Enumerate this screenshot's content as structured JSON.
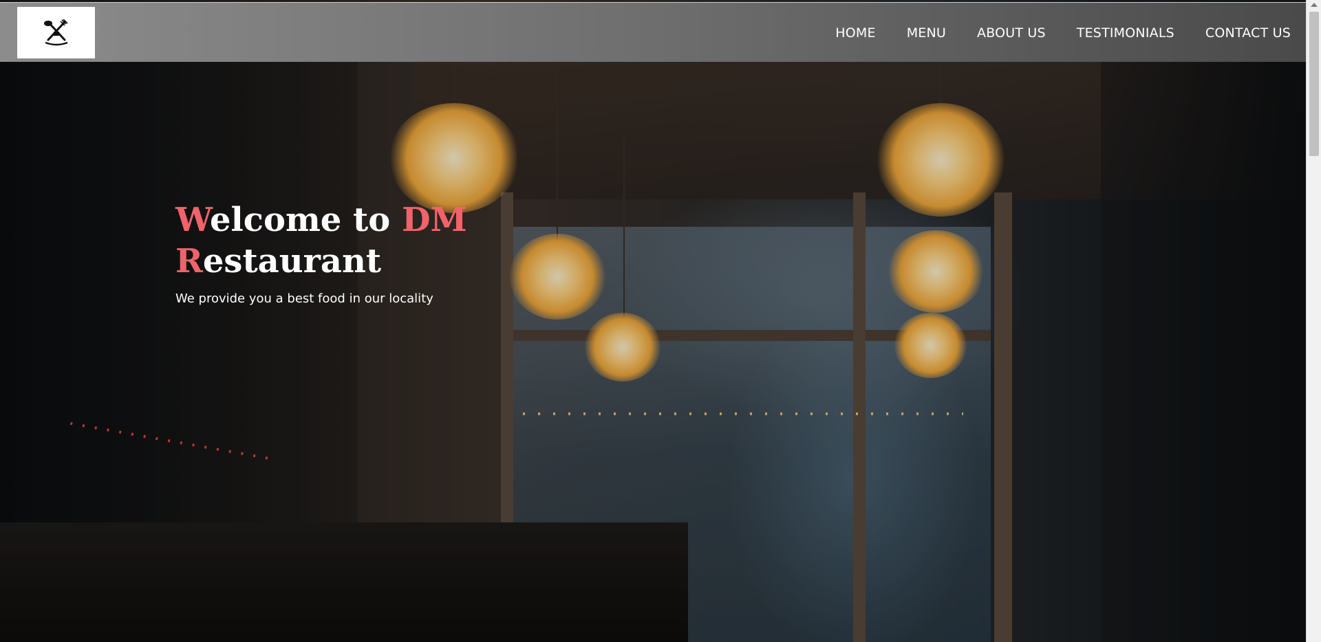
{
  "header": {
    "logo_alt": "DM Restaurant logo",
    "logo_icon": "fork-knife-icon"
  },
  "nav": {
    "items": [
      {
        "label": "HOME"
      },
      {
        "label": "MENU"
      },
      {
        "label": "ABOUT US"
      },
      {
        "label": "TESTIMONIALS"
      },
      {
        "label": "CONTACT US"
      }
    ]
  },
  "hero": {
    "title_line1_accent": "W",
    "title_line1_rest": "elcome to ",
    "title_line1_accent2": "DM",
    "title_line2_accent": "R",
    "title_line2_rest": "estaurant",
    "subtitle": "We provide you a best food in our locality",
    "accent_color": "#f0636b"
  }
}
